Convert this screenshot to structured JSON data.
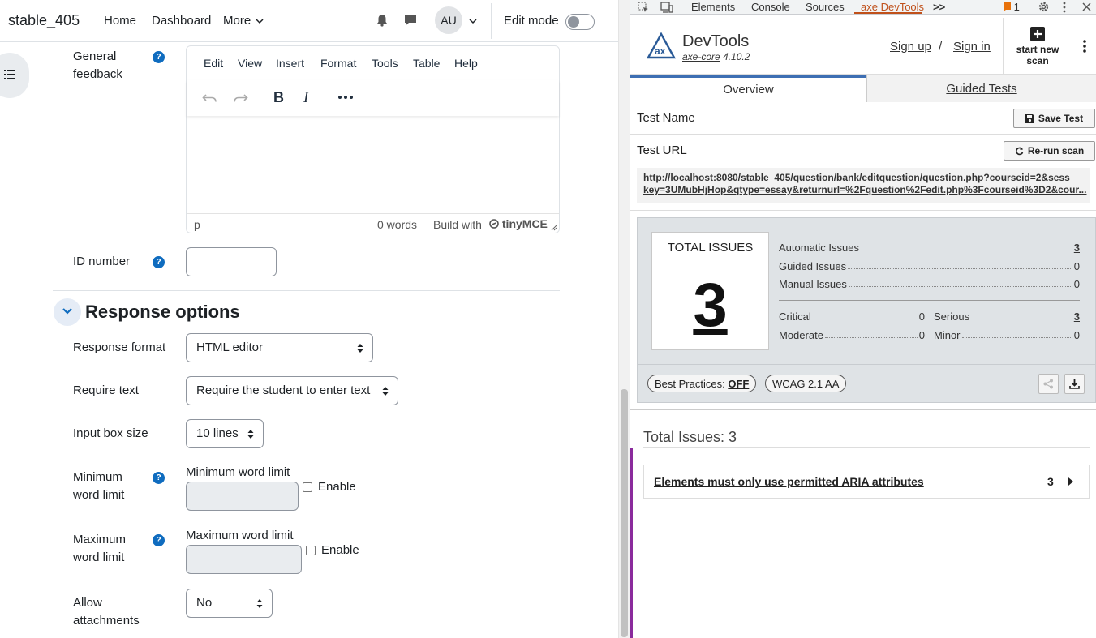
{
  "navbar": {
    "brand": "stable_405",
    "home": "Home",
    "dashboard": "Dashboard",
    "more": "More",
    "avatar": "AU",
    "edit_mode": "Edit mode"
  },
  "form": {
    "general_feedback_label_1": "General",
    "general_feedback_label_2": "feedback",
    "editor": {
      "menus": [
        "Edit",
        "View",
        "Insert",
        "Format",
        "Tools",
        "Table",
        "Help"
      ],
      "status_element": "p",
      "word_count": "0 words",
      "build_with": "Build with",
      "brand": "tinyMCE"
    },
    "id_number_label": "ID number",
    "section_title": "Response options",
    "response_format": {
      "label": "Response format",
      "value": "HTML editor"
    },
    "require_text": {
      "label": "Require text",
      "value": "Require the student to enter text"
    },
    "input_box_size": {
      "label": "Input box size",
      "value": "10 lines"
    },
    "min_word_limit": {
      "label_1": "Minimum",
      "label_2": "word limit",
      "sub_label": "Minimum word limit",
      "enable": "Enable"
    },
    "max_word_limit": {
      "label_1": "Maximum",
      "label_2": "word limit",
      "sub_label": "Maximum word limit",
      "enable": "Enable"
    },
    "allow_attachments": {
      "label_1": "Allow",
      "label_2": "attachments",
      "value": "No"
    }
  },
  "devtools": {
    "tabs": [
      "Elements",
      "Console",
      "Sources",
      "axe DevTools"
    ],
    "more_tabs": ">>",
    "issue_badge": "1",
    "axe": {
      "title": "DevTools",
      "core_name": "axe-core",
      "core_version": "4.10.2",
      "sign_up": "Sign up",
      "slash": "/",
      "sign_in": "Sign in",
      "start_scan_1": "start new",
      "start_scan_2": "scan",
      "tab_overview": "Overview",
      "tab_guided": "Guided Tests",
      "test_name_label": "Test Name",
      "save_test": "Save Test",
      "test_url_label": "Test URL",
      "rerun_scan": "Re-run scan",
      "url_line_1": "http://localhost:8080/stable_405/question/bank/editquestion/question.php?courseid=2&sess",
      "url_line_2": "key=3UMubHjHop&qtype=essay&returnurl=%2Fquestion%2Fedit.php%3Fcourseid%3D2&cour...",
      "total_issues_label": "TOTAL ISSUES",
      "total_issues": "3",
      "automatic_label": "Automatic Issues",
      "automatic": "3",
      "guided_label": "Guided Issues",
      "guided": "0",
      "manual_label": "Manual Issues",
      "manual": "0",
      "critical_label": "Critical",
      "critical": "0",
      "serious_label": "Serious",
      "serious": "3",
      "moderate_label": "Moderate",
      "moderate": "0",
      "minor_label": "Minor",
      "minor": "0",
      "best_practices_label": "Best Practices:",
      "best_practices_value": "OFF",
      "wcag": "WCAG 2.1 AA",
      "total_line": "Total Issues: 3",
      "issue_title": "Elements must only use permitted ARIA attributes",
      "issue_count": "3"
    }
  }
}
